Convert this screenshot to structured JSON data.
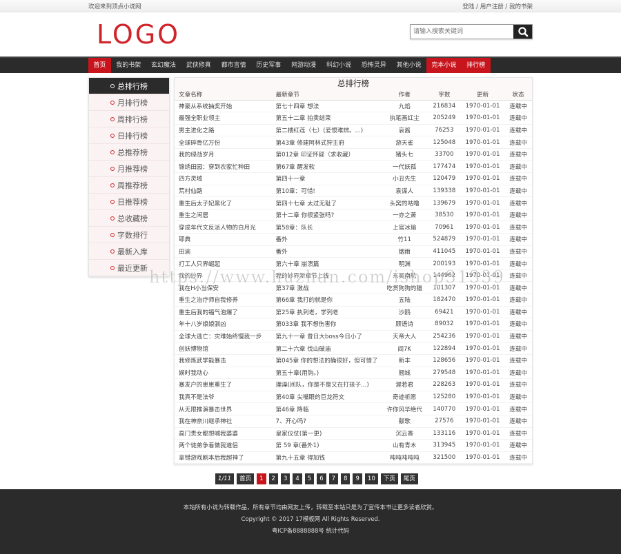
{
  "topbar": {
    "welcome": "欢迎来到顶点小说网",
    "links": [
      "登陆",
      "用户注册",
      "我的书架"
    ],
    "separator": " / "
  },
  "header": {
    "logo": "LOGO",
    "search_placeholder": "请输入搜索关键词",
    "search_icon": "search-icon"
  },
  "nav": {
    "items": [
      {
        "label": "首页",
        "highlight": true
      },
      {
        "label": "我的书架",
        "highlight": false
      },
      {
        "label": "玄幻魔法",
        "highlight": false
      },
      {
        "label": "武侠修真",
        "highlight": false
      },
      {
        "label": "都市言情",
        "highlight": false
      },
      {
        "label": "历史军事",
        "highlight": false
      },
      {
        "label": "网游动漫",
        "highlight": false
      },
      {
        "label": "科幻小说",
        "highlight": false
      },
      {
        "label": "恐怖灵异",
        "highlight": false
      },
      {
        "label": "其他小说",
        "highlight": false
      },
      {
        "label": "完本小说",
        "highlight": true
      },
      {
        "label": "排行榜",
        "highlight": true
      }
    ]
  },
  "sidebar": {
    "items": [
      {
        "label": "总排行榜",
        "active": true
      },
      {
        "label": "月排行榜",
        "active": false
      },
      {
        "label": "周排行榜",
        "active": false
      },
      {
        "label": "日排行榜",
        "active": false
      },
      {
        "label": "总推荐榜",
        "active": false
      },
      {
        "label": "月推荐榜",
        "active": false
      },
      {
        "label": "周推荐榜",
        "active": false
      },
      {
        "label": "日推荐榜",
        "active": false
      },
      {
        "label": "总收藏榜",
        "active": false
      },
      {
        "label": "字数排行",
        "active": false
      },
      {
        "label": "最新入库",
        "active": false
      },
      {
        "label": "最近更新",
        "active": false
      }
    ]
  },
  "ranking": {
    "title": "总排行榜",
    "columns": [
      "文章名称",
      "最新章节",
      "作者",
      "字数",
      "更新",
      "状态"
    ],
    "rows": [
      [
        "神豪从系统抽奖开始",
        "第七十四章 想法",
        "九焰",
        "216834",
        "1970-01-01",
        "连载中"
      ],
      [
        "最强全职业领主",
        "第五十二章 拍卖结束",
        "执笔画红尘",
        "205249",
        "1970-01-01",
        "连载中"
      ],
      [
        "男主进化之路",
        "第二楼红莲（七）(爱恨难辨。...)",
        "哀酱",
        "76253",
        "1970-01-01",
        "连载中"
      ],
      [
        "全球碎骨亿万份",
        "第43章 修建阿林式狩主府",
        "游天雀",
        "125048",
        "1970-01-01",
        "连载中"
      ],
      [
        "我的绿战岁月",
        "第012章 印证怀疑（求收藏）",
        "猪头七",
        "33700",
        "1970-01-01",
        "连载中"
      ],
      [
        "锦绣田园：穿到农家忙种田",
        "第67章 醒发软",
        "一代妖孤",
        "177474",
        "1970-01-01",
        "连载中"
      ],
      [
        "四方灵域",
        "第四十一章",
        "小丑先生",
        "120479",
        "1970-01-01",
        "连载中"
      ],
      [
        "荒村仙路",
        "第10章：可惜!",
        "袁谋人",
        "139338",
        "1970-01-01",
        "连载中"
      ],
      [
        "重生后太子妃黑化了",
        "第四十七章 太过无耻了",
        "头窝的咕噜",
        "139679",
        "1970-01-01",
        "连载中"
      ],
      [
        "重生之闲居",
        "第十二章 你很紧张吗?",
        "一亦之萧",
        "38530",
        "1970-01-01",
        "连载中"
      ],
      [
        "穿成年代文反派人物的白月光",
        "第58章：队长",
        "上官冰瑜",
        "70961",
        "1970-01-01",
        "连载中"
      ],
      [
        "耶典",
        "番外",
        "竹11",
        "524879",
        "1970-01-01",
        "连载中"
      ],
      [
        "田渝",
        "番外",
        "烟雨",
        "411045",
        "1970-01-01",
        "连载中"
      ],
      [
        "打工人只界崛起",
        "第六十章 崩溃篇",
        "明渊",
        "200193",
        "1970-01-01",
        "连载中"
      ],
      [
        "我的妙界",
        "我的妙界新章节上线",
        "东吴南航",
        "144962",
        "1970-01-01",
        "连载中"
      ],
      [
        "我在H小当保安",
        "第37章 激战",
        "吃货狗狗的猫",
        "101307",
        "1970-01-01",
        "连载中"
      ],
      [
        "重生之治疗师自我修养",
        "第66章 我打的就是你",
        "五陆",
        "182470",
        "1970-01-01",
        "连载中"
      ],
      [
        "重生后我的福气泡爆了",
        "第25章 执列老，学列老",
        "沙鸥",
        "69421",
        "1970-01-01",
        "连载中"
      ],
      [
        "年十八岁娘娘驯凶",
        "第033章 我不想伤害你",
        "顾语诗",
        "89032",
        "1970-01-01",
        "连载中"
      ],
      [
        "全球大逃亡：灾难始终慢我一步",
        "第九十一章 昔日大boss今日小了",
        "天帝大人",
        "254236",
        "1970-01-01",
        "连载中"
      ],
      [
        "创妖博物馆",
        "第二十六章 伐山破庙",
        "阎7K",
        "122894",
        "1970-01-01",
        "连载中"
      ],
      [
        "我修炼武学能暴击",
        "第045章 你的想法的确很好，但可惜了",
        "新丰",
        "128656",
        "1970-01-01",
        "连载中"
      ],
      [
        "娱时我动心",
        "第五十章(用钩。)",
        "翘城",
        "279548",
        "1970-01-01",
        "连载中"
      ],
      [
        "暴发户的崽崽重生了",
        "理澡(间队，你是不是又在打孩子...)",
        "渥若君",
        "228263",
        "1970-01-01",
        "连载中"
      ],
      [
        "我真不是法爷",
        "第40章 尖嘴眼的巨龙符文",
        "奇迹祈愿",
        "125280",
        "1970-01-01",
        "连载中"
      ],
      [
        "从无限推演暴击世界",
        "第46章 降临",
        "许你风华绝代",
        "140770",
        "1970-01-01",
        "连载中"
      ],
      [
        "我在神奈川继承神社",
        "7、开心吗?",
        "献歌",
        "27576",
        "1970-01-01",
        "连载中"
      ],
      [
        "高门贵女都想喊我婆婆",
        "皇家仪仗(第一更)",
        "沉云香",
        "133116",
        "1970-01-01",
        "连载中"
      ],
      [
        "两个徒弟争着做我道侣",
        "第 59 章(番外1)",
        "山有青木",
        "313945",
        "1970-01-01",
        "连载中"
      ],
      [
        "拿错游戏剧本后我超神了",
        "第九十五章 得加钱",
        "吨吨吨吨吨",
        "321500",
        "1970-01-01",
        "连载中"
      ]
    ]
  },
  "pager": {
    "info": "1/11",
    "first": "首页",
    "pages": [
      "1",
      "2",
      "3",
      "4",
      "5",
      "6",
      "7",
      "8",
      "9",
      "10"
    ],
    "current": "1",
    "next": "下页",
    "last": "尾页"
  },
  "footer": {
    "notice": "本站所有小说为转载作品，所有章节均由网友上传，转载至本站只是为了宣传本书让更多读者欣赏。",
    "copyright": "Copyright © 2017 17模板网 All Rights Reserved.",
    "icp": "粤ICP备8888888号 统计代码"
  },
  "watermark": "https://www.huzhan.com/ishop31339",
  "colors": {
    "accent_red": "#c8141c",
    "dark": "#2b2b2b"
  }
}
